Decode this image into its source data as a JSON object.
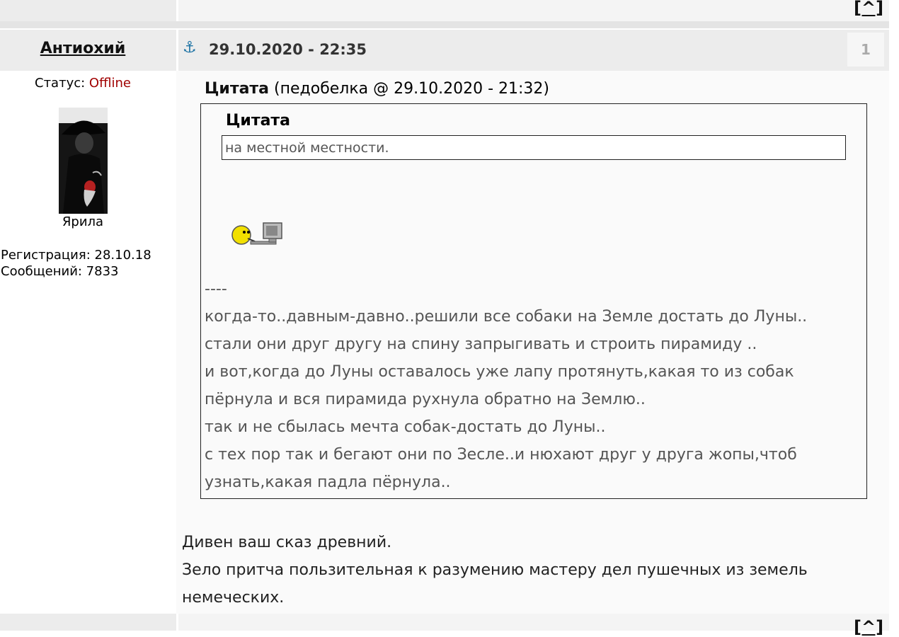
{
  "nav": {
    "to_top_label": "[^]"
  },
  "post": {
    "author": "Антиохий",
    "date": "29.10.2020 - 22:35",
    "number": "1",
    "profile": {
      "status_label": "Статус:",
      "status_value": "Offline",
      "rank": "Ярила",
      "registration": "Регистрация: 28.10.18",
      "messages": "Сообщений: 7833"
    },
    "quote": {
      "label": "Цитата",
      "source": "(педобелка @ 29.10.2020 - 21:32)",
      "inner_label": "Цитата",
      "inner_text": "на местной местности.",
      "lines": [
        "----",
        "когда-то..давным-давно..решили все собаки на Земле достать до Луны..",
        "стали они друг другу на спину запрыгивать и строить пирамиду ..",
        "и вот,когда до Луны оставалось уже лапу протянуть,какая то из собак",
        "пёрнула и вся пирамида рухнула обратно на Землю..",
        "так и не сбылась мечта собак-достать до Луны..",
        "с тех пор так и бегают они по Зесле..и нюхают друг у друга жопы,чтоб",
        "узнать,какая падла пёрнула.."
      ]
    },
    "reply_lines": [
      "Дивен ваш сказ древний.",
      "Зело притча пользительная к разумению мастеру дел пушечных из земель",
      "немеческих."
    ]
  }
}
